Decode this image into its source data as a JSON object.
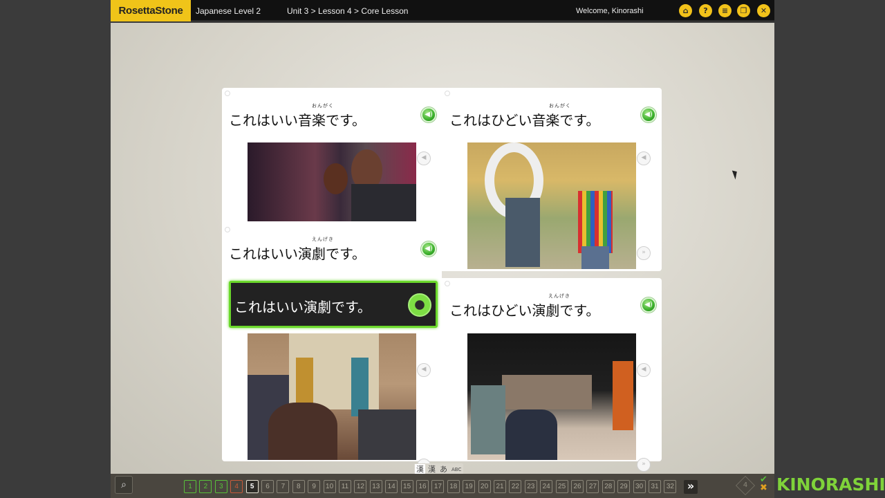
{
  "app": {
    "logo": "RosettaStone",
    "course": "Japanese Level 2",
    "breadcrumb": "Unit 3 > Lesson 4 > Core Lesson",
    "welcome": "Welcome, Kinorashi"
  },
  "top_icons": [
    "home-icon",
    "help-icon",
    "menu-list-icon",
    "window-icon",
    "close-icon"
  ],
  "panels": [
    {
      "id": "top-left",
      "furigana": "おんがく",
      "sentence": "これはいい音楽です。"
    },
    {
      "id": "top-right",
      "furigana": "おんがく",
      "sentence": "これはひどい音楽です。"
    },
    {
      "id": "middle-left",
      "furigana": "えんげき",
      "sentence": "これはいい演劇です。"
    },
    {
      "id": "bottom-right",
      "furigana": "えんげき",
      "sentence": "これはひどい演劇です。"
    }
  ],
  "selected_answer": {
    "sentence": "これはいい演劇です。"
  },
  "modes": [
    "漢",
    "漢",
    "あ",
    "ABC"
  ],
  "lessons": {
    "items": [
      "1",
      "2",
      "3",
      "4",
      "5",
      "6",
      "7",
      "8",
      "9",
      "10",
      "11",
      "12",
      "13",
      "14",
      "15",
      "16",
      "17",
      "18",
      "19",
      "20",
      "21",
      "22",
      "23",
      "24",
      "25",
      "26",
      "27",
      "28",
      "29",
      "30",
      "31",
      "32"
    ],
    "done_count": 3,
    "wrong_index": 3,
    "current_index": 4
  },
  "score": {
    "value": "4"
  },
  "watermark": "KINORASHI",
  "colors": {
    "brand": "#f0c419",
    "correct": "#58c23a",
    "incorrect": "#c85a3a"
  }
}
